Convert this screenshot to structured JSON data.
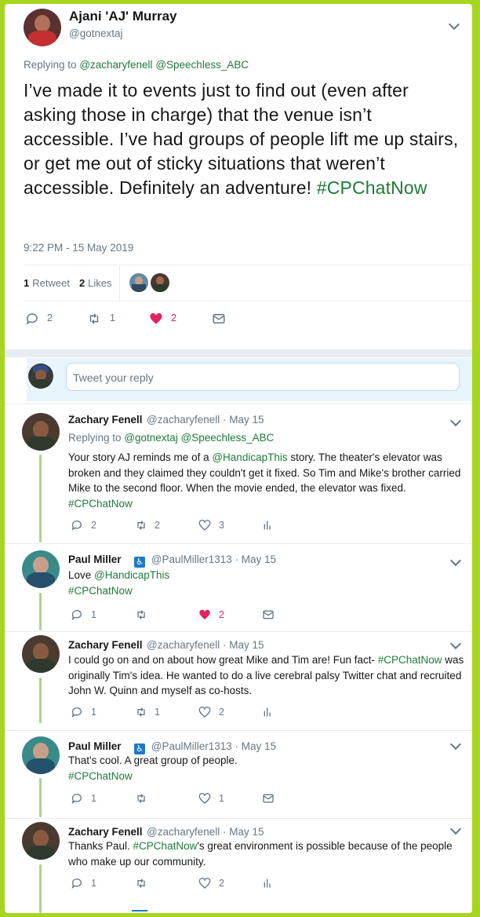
{
  "main": {
    "name": "Ajani 'AJ' Murray",
    "handle": "@gotnextaj",
    "replying_prefix": "Replying to",
    "replying_to": [
      "@zacharyfenell",
      "@Speechless_ABC"
    ],
    "text": "I’ve made it to events just to find out (even after asking those in charge) that the venue isn’t accessible. I’ve had groups of people lift me up stairs,  or get me out of sticky situations that weren’t accessible. Definitely an adventure! ",
    "hashtag": "#CPChatNow",
    "timestamp": "9:22 PM - 15 May 2019",
    "retweets_count": "1",
    "retweets_label": "Retweet",
    "likes_count": "2",
    "likes_label": "Likes",
    "reply_count": "2",
    "retweet_action_count": "1",
    "like_action_count": "2"
  },
  "reply_box": {
    "placeholder": "Tweet your reply"
  },
  "replies": [
    {
      "name": "Zachary Fenell",
      "handle": "@zacharyfenell",
      "date": "· May 15",
      "replying_prefix": "Replying to",
      "replying_to": [
        "@gotnextaj",
        "@Speechless_ABC"
      ],
      "text_before": "Your story AJ reminds me of a ",
      "mention": "@HandicapThis",
      "text_after": " story. The theater's elevator was broken and they claimed they couldn't get it fixed. So Tim and Mike's brother carried Mike to the second floor. When the movie ended, the elevator was fixed.",
      "hashtag": "#CPChatNow",
      "reply_count": "2",
      "retweet_count": "2",
      "like_count": "3"
    },
    {
      "name": "Paul Miller",
      "handle": "@PaulMiller1313",
      "date": "· May 15",
      "text_before": "Love ",
      "mention": "@HandicapThis",
      "hashtag": "#CPChatNow",
      "reply_count": "1",
      "like_count": "2"
    },
    {
      "name": "Zachary Fenell",
      "handle": "@zacharyfenell",
      "date": "· May 15",
      "text_before": "I could go on and on about how great Mike and Tim are! Fun fact- ",
      "hashtag": "#CPChatNow",
      "text_after": " was originally Tim's idea. He wanted to do a live cerebral palsy Twitter chat and recruited John W. Quinn and myself as co-hosts.",
      "reply_count": "1",
      "retweet_count": "1",
      "like_count": "2"
    },
    {
      "name": "Paul Miller",
      "handle": "@PaulMiller1313",
      "date": "· May 15",
      "text": "That's cool. A great group of people.",
      "hashtag": "#CPChatNow",
      "reply_count": "1",
      "like_count": "1"
    },
    {
      "name": "Zachary Fenell",
      "handle": "@zacharyfenell",
      "date": "· May 15",
      "text_before": "Thanks Paul. ",
      "hashtag": "#CPChatNow",
      "text_after": "'s great environment is possible because of the people who make up our community.",
      "reply_count": "1",
      "like_count": "2"
    }
  ],
  "colors": {
    "border": "#a6d61e",
    "link": "#1f7a3a",
    "like": "#e0245e",
    "muted": "#657786"
  },
  "icons": [
    "chevron-down-icon",
    "reply-icon",
    "retweet-icon",
    "heart-icon",
    "dm-icon",
    "analytics-icon",
    "accessibility-icon"
  ]
}
